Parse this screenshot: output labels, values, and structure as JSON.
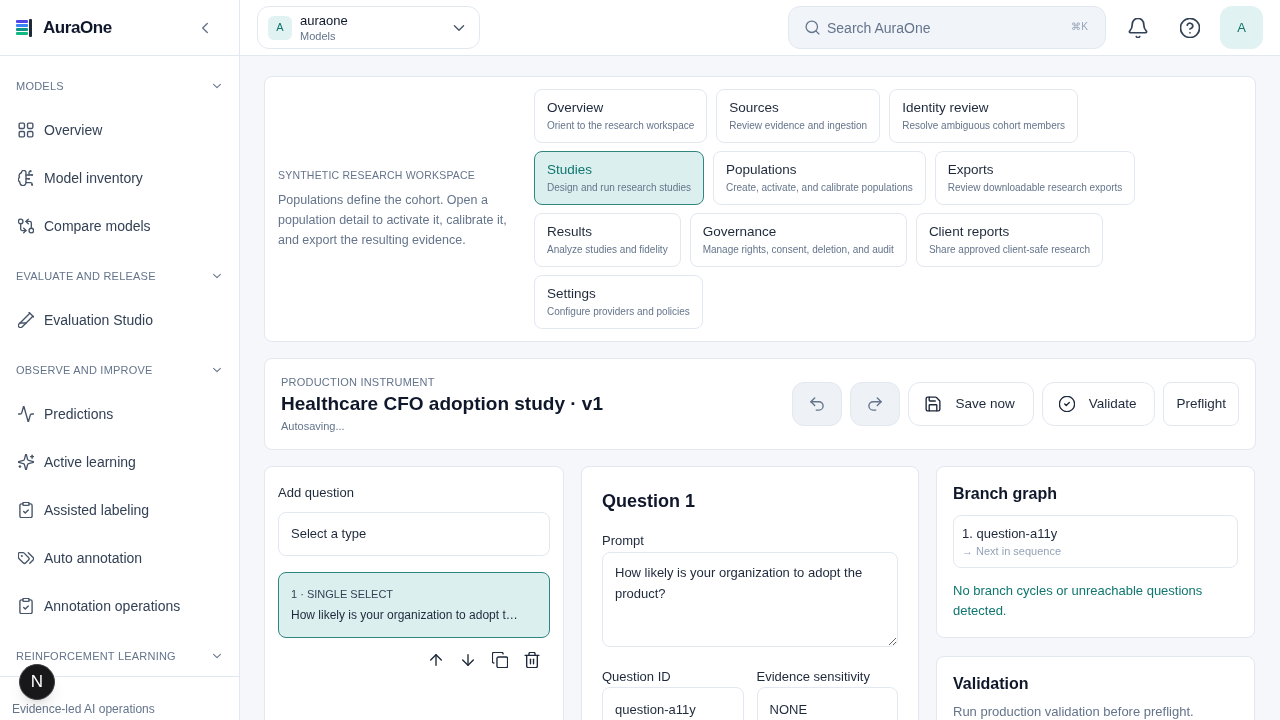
{
  "sidebar": {
    "brand": "AuraOne",
    "sections": [
      {
        "title": "MODELS",
        "expanded": true,
        "items": [
          {
            "label": "Overview"
          },
          {
            "label": "Model inventory"
          },
          {
            "label": "Compare models"
          }
        ]
      },
      {
        "title": "EVALUATE AND RELEASE",
        "expanded": true,
        "items": [
          {
            "label": "Evaluation Studio"
          }
        ]
      },
      {
        "title": "OBSERVE AND IMPROVE",
        "expanded": true,
        "items": [
          {
            "label": "Predictions"
          },
          {
            "label": "Active learning"
          },
          {
            "label": "Assisted labeling"
          },
          {
            "label": "Auto annotation"
          },
          {
            "label": "Annotation operations"
          }
        ]
      },
      {
        "title": "REINFORCEMENT LEARNING",
        "expanded": true
      }
    ],
    "footer": "Evidence-led AI operations"
  },
  "dev_indicator": {
    "label": "N"
  },
  "topbar": {
    "workspace": {
      "avatar": "A",
      "name": "auraone",
      "context": "Models"
    },
    "search": {
      "placeholder": "Search AuraOne",
      "shortcut": "⌘K"
    },
    "user_avatar": "A"
  },
  "research_workspace": {
    "eyebrow": "SYNTHETIC RESEARCH WORKSPACE",
    "description": "Populations define the cohort. Open a population detail to activate it, calibrate it, and export the resulting evidence.",
    "tabs": [
      {
        "title": "Overview",
        "subtitle": "Orient to the research workspace",
        "selected": false
      },
      {
        "title": "Sources",
        "subtitle": "Review evidence and ingestion",
        "selected": false
      },
      {
        "title": "Identity review",
        "subtitle": "Resolve ambiguous cohort members",
        "selected": false
      },
      {
        "title": "Studies",
        "subtitle": "Design and run research studies",
        "selected": true
      },
      {
        "title": "Populations",
        "subtitle": "Create, activate, and calibrate populations",
        "selected": false
      },
      {
        "title": "Exports",
        "subtitle": "Review downloadable research exports",
        "selected": false
      },
      {
        "title": "Results",
        "subtitle": "Analyze studies and fidelity",
        "selected": false
      },
      {
        "title": "Governance",
        "subtitle": "Manage rights, consent, deletion, and audit",
        "selected": false
      },
      {
        "title": "Client reports",
        "subtitle": "Share approved client-safe research",
        "selected": false
      },
      {
        "title": "Settings",
        "subtitle": "Configure providers and policies",
        "selected": false
      }
    ]
  },
  "instrument": {
    "eyebrow": "PRODUCTION INSTRUMENT",
    "title": "Healthcare CFO adoption study · v1",
    "status": "Autosaving...",
    "actions": [
      {
        "kind": "undo",
        "disabled": true
      },
      {
        "kind": "redo",
        "disabled": true
      },
      {
        "kind": "save",
        "label": "Save now",
        "disabled": false
      },
      {
        "kind": "validate",
        "label": "Validate",
        "disabled": false
      },
      {
        "kind": "preflight",
        "label": "Preflight",
        "disabled": false
      }
    ]
  },
  "question_list": {
    "label": "Add question",
    "type_select": {
      "value": "Select a type"
    },
    "questions": [
      {
        "meta": "1 · SINGLE SELECT",
        "prompt": "How likely is your organization to adopt t…",
        "selected": true
      }
    ]
  },
  "question_editor": {
    "title": "Question 1",
    "prompt": {
      "label": "Prompt",
      "value": "How likely is your organization to adopt the product?"
    },
    "fields": [
      {
        "label": "Question ID",
        "value": "question-a11y"
      },
      {
        "label": "Evidence sensitivity",
        "value": "NONE"
      }
    ]
  },
  "branch_graph": {
    "title": "Branch graph",
    "nodes": [
      {
        "label": "1. question-a11y",
        "next": "→ Next in sequence"
      }
    ],
    "status": "No branch cycles or unreachable questions detected."
  },
  "validation": {
    "title": "Validation",
    "description": "Run production validation before preflight."
  }
}
